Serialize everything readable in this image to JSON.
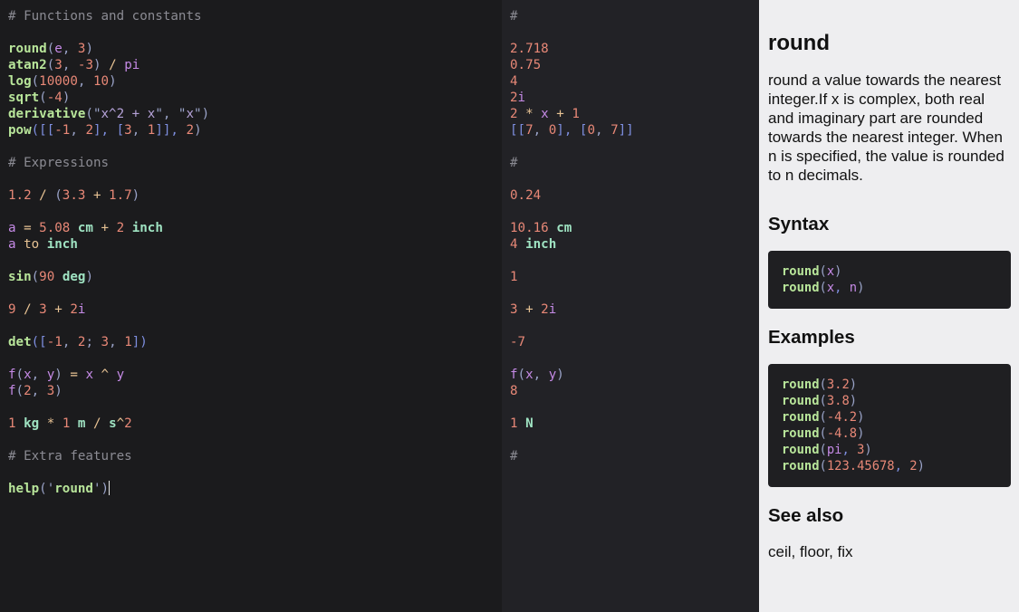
{
  "editor": {
    "lines": [
      [
        {
          "t": "# Functions and constants",
          "c": "comment"
        }
      ],
      [],
      [
        {
          "t": "round",
          "c": "fn"
        },
        {
          "t": "(",
          "c": "punc"
        },
        {
          "t": "e",
          "c": "var"
        },
        {
          "t": ", ",
          "c": "punc"
        },
        {
          "t": "3",
          "c": "num"
        },
        {
          "t": ")",
          "c": "punc"
        }
      ],
      [
        {
          "t": "atan2",
          "c": "fn"
        },
        {
          "t": "(",
          "c": "punc"
        },
        {
          "t": "3",
          "c": "num"
        },
        {
          "t": ", ",
          "c": "punc"
        },
        {
          "t": "-3",
          "c": "num"
        },
        {
          "t": ") ",
          "c": "punc"
        },
        {
          "t": "/",
          "c": "op"
        },
        {
          "t": " ",
          "c": "punc"
        },
        {
          "t": "pi",
          "c": "var"
        }
      ],
      [
        {
          "t": "log",
          "c": "fn"
        },
        {
          "t": "(",
          "c": "punc"
        },
        {
          "t": "10000",
          "c": "num"
        },
        {
          "t": ", ",
          "c": "punc"
        },
        {
          "t": "10",
          "c": "num"
        },
        {
          "t": ")",
          "c": "punc"
        }
      ],
      [
        {
          "t": "sqrt",
          "c": "fn"
        },
        {
          "t": "(",
          "c": "punc"
        },
        {
          "t": "-4",
          "c": "num"
        },
        {
          "t": ")",
          "c": "punc"
        }
      ],
      [
        {
          "t": "derivative",
          "c": "fn"
        },
        {
          "t": "(\"",
          "c": "punc"
        },
        {
          "t": "x^2 + x",
          "c": "str"
        },
        {
          "t": "\", \"",
          "c": "punc"
        },
        {
          "t": "x",
          "c": "str"
        },
        {
          "t": "\")",
          "c": "punc"
        }
      ],
      [
        {
          "t": "pow",
          "c": "fn"
        },
        {
          "t": "([[",
          "c": "brk"
        },
        {
          "t": "-1",
          "c": "num"
        },
        {
          "t": ", ",
          "c": "punc"
        },
        {
          "t": "2",
          "c": "num"
        },
        {
          "t": "], [",
          "c": "brk"
        },
        {
          "t": "3",
          "c": "num"
        },
        {
          "t": ", ",
          "c": "punc"
        },
        {
          "t": "1",
          "c": "num"
        },
        {
          "t": "]], ",
          "c": "brk"
        },
        {
          "t": "2",
          "c": "num"
        },
        {
          "t": ")",
          "c": "punc"
        }
      ],
      [],
      [
        {
          "t": "# Expressions",
          "c": "comment"
        }
      ],
      [],
      [
        {
          "t": "1.2",
          "c": "num"
        },
        {
          "t": " / ",
          "c": "op"
        },
        {
          "t": "(",
          "c": "punc"
        },
        {
          "t": "3.3",
          "c": "num"
        },
        {
          "t": " + ",
          "c": "op"
        },
        {
          "t": "1.7",
          "c": "num"
        },
        {
          "t": ")",
          "c": "punc"
        }
      ],
      [],
      [
        {
          "t": "a",
          "c": "var"
        },
        {
          "t": " = ",
          "c": "op"
        },
        {
          "t": "5.08",
          "c": "num"
        },
        {
          "t": " ",
          "c": "op"
        },
        {
          "t": "cm",
          "c": "unit"
        },
        {
          "t": " + ",
          "c": "op"
        },
        {
          "t": "2",
          "c": "num"
        },
        {
          "t": " ",
          "c": "op"
        },
        {
          "t": "inch",
          "c": "unit"
        }
      ],
      [
        {
          "t": "a",
          "c": "var"
        },
        {
          "t": " to ",
          "c": "op"
        },
        {
          "t": "inch",
          "c": "unit"
        }
      ],
      [],
      [
        {
          "t": "sin",
          "c": "fn"
        },
        {
          "t": "(",
          "c": "punc"
        },
        {
          "t": "90",
          "c": "num"
        },
        {
          "t": " ",
          "c": "op"
        },
        {
          "t": "deg",
          "c": "unit"
        },
        {
          "t": ")",
          "c": "punc"
        }
      ],
      [],
      [
        {
          "t": "9",
          "c": "num"
        },
        {
          "t": " / ",
          "c": "op"
        },
        {
          "t": "3",
          "c": "num"
        },
        {
          "t": " + ",
          "c": "op"
        },
        {
          "t": "2",
          "c": "num"
        },
        {
          "t": "i",
          "c": "var"
        }
      ],
      [],
      [
        {
          "t": "det",
          "c": "fn"
        },
        {
          "t": "([",
          "c": "brk"
        },
        {
          "t": "-1",
          "c": "num"
        },
        {
          "t": ", ",
          "c": "punc"
        },
        {
          "t": "2",
          "c": "num"
        },
        {
          "t": "; ",
          "c": "punc"
        },
        {
          "t": "3",
          "c": "num"
        },
        {
          "t": ", ",
          "c": "punc"
        },
        {
          "t": "1",
          "c": "num"
        },
        {
          "t": "])",
          "c": "brk"
        }
      ],
      [],
      [
        {
          "t": "f",
          "c": "var"
        },
        {
          "t": "(",
          "c": "punc"
        },
        {
          "t": "x",
          "c": "var"
        },
        {
          "t": ", ",
          "c": "punc"
        },
        {
          "t": "y",
          "c": "var"
        },
        {
          "t": ")",
          "c": "punc"
        },
        {
          "t": " = ",
          "c": "op"
        },
        {
          "t": "x",
          "c": "var"
        },
        {
          "t": " ^ ",
          "c": "op"
        },
        {
          "t": "y",
          "c": "var"
        }
      ],
      [
        {
          "t": "f",
          "c": "var"
        },
        {
          "t": "(",
          "c": "punc"
        },
        {
          "t": "2",
          "c": "num"
        },
        {
          "t": ", ",
          "c": "punc"
        },
        {
          "t": "3",
          "c": "num"
        },
        {
          "t": ")",
          "c": "punc"
        }
      ],
      [],
      [
        {
          "t": "1",
          "c": "num"
        },
        {
          "t": " ",
          "c": "op"
        },
        {
          "t": "kg",
          "c": "unit"
        },
        {
          "t": " * ",
          "c": "op"
        },
        {
          "t": "1",
          "c": "num"
        },
        {
          "t": " ",
          "c": "op"
        },
        {
          "t": "m",
          "c": "unit"
        },
        {
          "t": " / ",
          "c": "op"
        },
        {
          "t": "s",
          "c": "unit"
        },
        {
          "t": "^",
          "c": "op"
        },
        {
          "t": "2",
          "c": "num"
        }
      ],
      [],
      [
        {
          "t": "# Extra features",
          "c": "comment"
        }
      ],
      [],
      [
        {
          "t": "help",
          "c": "fn"
        },
        {
          "t": "('",
          "c": "punc"
        },
        {
          "t": "round",
          "c": "fn"
        },
        {
          "t": "')",
          "c": "punc"
        },
        {
          "cursor": true
        }
      ]
    ]
  },
  "results": {
    "lines": [
      [
        {
          "t": "#",
          "c": "comment"
        }
      ],
      [],
      [
        {
          "t": "2.718",
          "c": "num"
        }
      ],
      [
        {
          "t": "0.75",
          "c": "num"
        }
      ],
      [
        {
          "t": "4",
          "c": "num"
        }
      ],
      [
        {
          "t": "2",
          "c": "num"
        },
        {
          "t": "i",
          "c": "var"
        }
      ],
      [
        {
          "t": "2",
          "c": "num"
        },
        {
          "t": " * ",
          "c": "op"
        },
        {
          "t": "x",
          "c": "var"
        },
        {
          "t": " + ",
          "c": "op"
        },
        {
          "t": "1",
          "c": "num"
        }
      ],
      [
        {
          "t": "[[",
          "c": "brk"
        },
        {
          "t": "7",
          "c": "num"
        },
        {
          "t": ", ",
          "c": "punc"
        },
        {
          "t": "0",
          "c": "num"
        },
        {
          "t": "], [",
          "c": "brk"
        },
        {
          "t": "0",
          "c": "num"
        },
        {
          "t": ", ",
          "c": "punc"
        },
        {
          "t": "7",
          "c": "num"
        },
        {
          "t": "]]",
          "c": "brk"
        }
      ],
      [],
      [
        {
          "t": "#",
          "c": "comment"
        }
      ],
      [],
      [
        {
          "t": "0.24",
          "c": "num"
        }
      ],
      [],
      [
        {
          "t": "10.16",
          "c": "num"
        },
        {
          "t": " ",
          "c": "op"
        },
        {
          "t": "cm",
          "c": "unit"
        }
      ],
      [
        {
          "t": "4",
          "c": "num"
        },
        {
          "t": " ",
          "c": "op"
        },
        {
          "t": "inch",
          "c": "unit"
        }
      ],
      [],
      [
        {
          "t": "1",
          "c": "num"
        }
      ],
      [],
      [
        {
          "t": "3",
          "c": "num"
        },
        {
          "t": " + ",
          "c": "op"
        },
        {
          "t": "2",
          "c": "num"
        },
        {
          "t": "i",
          "c": "var"
        }
      ],
      [],
      [
        {
          "t": "-7",
          "c": "num"
        }
      ],
      [],
      [
        {
          "t": "f",
          "c": "var"
        },
        {
          "t": "(",
          "c": "punc"
        },
        {
          "t": "x",
          "c": "var"
        },
        {
          "t": ", ",
          "c": "punc"
        },
        {
          "t": "y",
          "c": "var"
        },
        {
          "t": ")",
          "c": "punc"
        }
      ],
      [
        {
          "t": "8",
          "c": "num"
        }
      ],
      [],
      [
        {
          "t": "1",
          "c": "num"
        },
        {
          "t": " ",
          "c": "op"
        },
        {
          "t": "N",
          "c": "unit"
        }
      ],
      [],
      [
        {
          "t": "#",
          "c": "comment"
        }
      ]
    ]
  },
  "help": {
    "title": "round",
    "description": "round a value towards the nearest integer.If x is complex, both real and imaginary part are rounded towards the nearest integer. When n is specified, the value is rounded to n decimals.",
    "syntax_heading": "Syntax",
    "syntax": [
      [
        {
          "t": "round",
          "c": "fn"
        },
        {
          "t": "(",
          "c": "punc"
        },
        {
          "t": "x",
          "c": "var"
        },
        {
          "t": ")",
          "c": "punc"
        }
      ],
      [
        {
          "t": "round",
          "c": "fn"
        },
        {
          "t": "(",
          "c": "punc"
        },
        {
          "t": "x",
          "c": "var"
        },
        {
          "t": ", ",
          "c": "brk"
        },
        {
          "t": "n",
          "c": "var"
        },
        {
          "t": ")",
          "c": "punc"
        }
      ]
    ],
    "examples_heading": "Examples",
    "examples": [
      [
        {
          "t": "round",
          "c": "fn"
        },
        {
          "t": "(",
          "c": "punc"
        },
        {
          "t": "3.2",
          "c": "num"
        },
        {
          "t": ")",
          "c": "punc"
        }
      ],
      [
        {
          "t": "round",
          "c": "fn"
        },
        {
          "t": "(",
          "c": "punc"
        },
        {
          "t": "3.8",
          "c": "num"
        },
        {
          "t": ")",
          "c": "punc"
        }
      ],
      [
        {
          "t": "round",
          "c": "fn"
        },
        {
          "t": "(",
          "c": "punc"
        },
        {
          "t": "-4.2",
          "c": "num"
        },
        {
          "t": ")",
          "c": "punc"
        }
      ],
      [
        {
          "t": "round",
          "c": "fn"
        },
        {
          "t": "(",
          "c": "punc"
        },
        {
          "t": "-4.8",
          "c": "num"
        },
        {
          "t": ")",
          "c": "punc"
        }
      ],
      [
        {
          "t": "round",
          "c": "fn"
        },
        {
          "t": "(",
          "c": "punc"
        },
        {
          "t": "pi",
          "c": "var"
        },
        {
          "t": ", ",
          "c": "brk"
        },
        {
          "t": "3",
          "c": "num"
        },
        {
          "t": ")",
          "c": "punc"
        }
      ],
      [
        {
          "t": "round",
          "c": "fn"
        },
        {
          "t": "(",
          "c": "punc"
        },
        {
          "t": "123.45678",
          "c": "num"
        },
        {
          "t": ", ",
          "c": "brk"
        },
        {
          "t": "2",
          "c": "num"
        },
        {
          "t": ")",
          "c": "punc"
        }
      ]
    ],
    "see_also_heading": "See also",
    "see_also": "ceil, floor, fix"
  }
}
